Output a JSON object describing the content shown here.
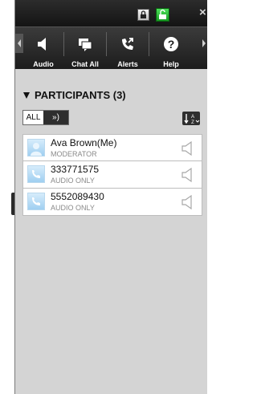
{
  "window": {
    "lock_icon": "lock-icon",
    "unlock_icon": "unlock-icon",
    "close_glyph": "×"
  },
  "toolbar": {
    "items": [
      {
        "label": "Audio",
        "icon": "speaker-icon"
      },
      {
        "label": "Chat All",
        "icon": "chat-icon"
      },
      {
        "label": "Alerts",
        "icon": "phone-alert-icon"
      },
      {
        "label": "Help",
        "icon": "help-icon"
      }
    ]
  },
  "participants": {
    "title": "PARTICIPANTS (3)",
    "filter_all": "ALL",
    "filter_speaking": "»)",
    "sort_icon": "sort-az-icon",
    "rows": [
      {
        "name": "Ava Brown(Me)",
        "role": "MODERATOR",
        "icon": "user-icon"
      },
      {
        "name": "333771575",
        "role": "AUDIO ONLY",
        "icon": "phone-icon"
      },
      {
        "name": "5552089430",
        "role": "AUDIO ONLY",
        "icon": "phone-icon"
      }
    ]
  },
  "colors": {
    "panel_bg": "#d4d4d4",
    "toolbar_bg": "#1c1c1c",
    "unlock_green": "#1fb52c",
    "avatar_blue": "#9fcff1"
  }
}
